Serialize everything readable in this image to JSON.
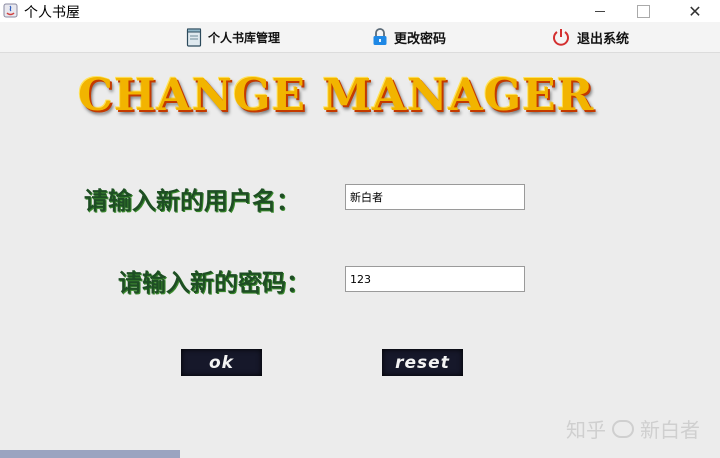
{
  "window": {
    "title": "个人书屋",
    "minimize_glyph": "",
    "close_glyph": "✕"
  },
  "menu": {
    "items": [
      {
        "label": "个人书库管理",
        "icon": "book-icon"
      },
      {
        "label": "更改密码",
        "icon": "lock-icon"
      },
      {
        "label": "退出系统",
        "icon": "power-icon"
      }
    ]
  },
  "banner": {
    "text": "CHANGE MANAGER"
  },
  "form": {
    "username_label": "请输入新的用户名：",
    "username_value": "新白者",
    "password_label": "请输入新的密码：",
    "password_value": "123"
  },
  "buttons": {
    "ok": "ok",
    "reset": "reset"
  },
  "watermark": {
    "left": "知乎",
    "right": "新白者"
  },
  "colors": {
    "banner": "#f2b400",
    "label": "#1e4e24",
    "button_bg": "#16182a",
    "lock": "#1e88e5",
    "power": "#d32f2f"
  }
}
